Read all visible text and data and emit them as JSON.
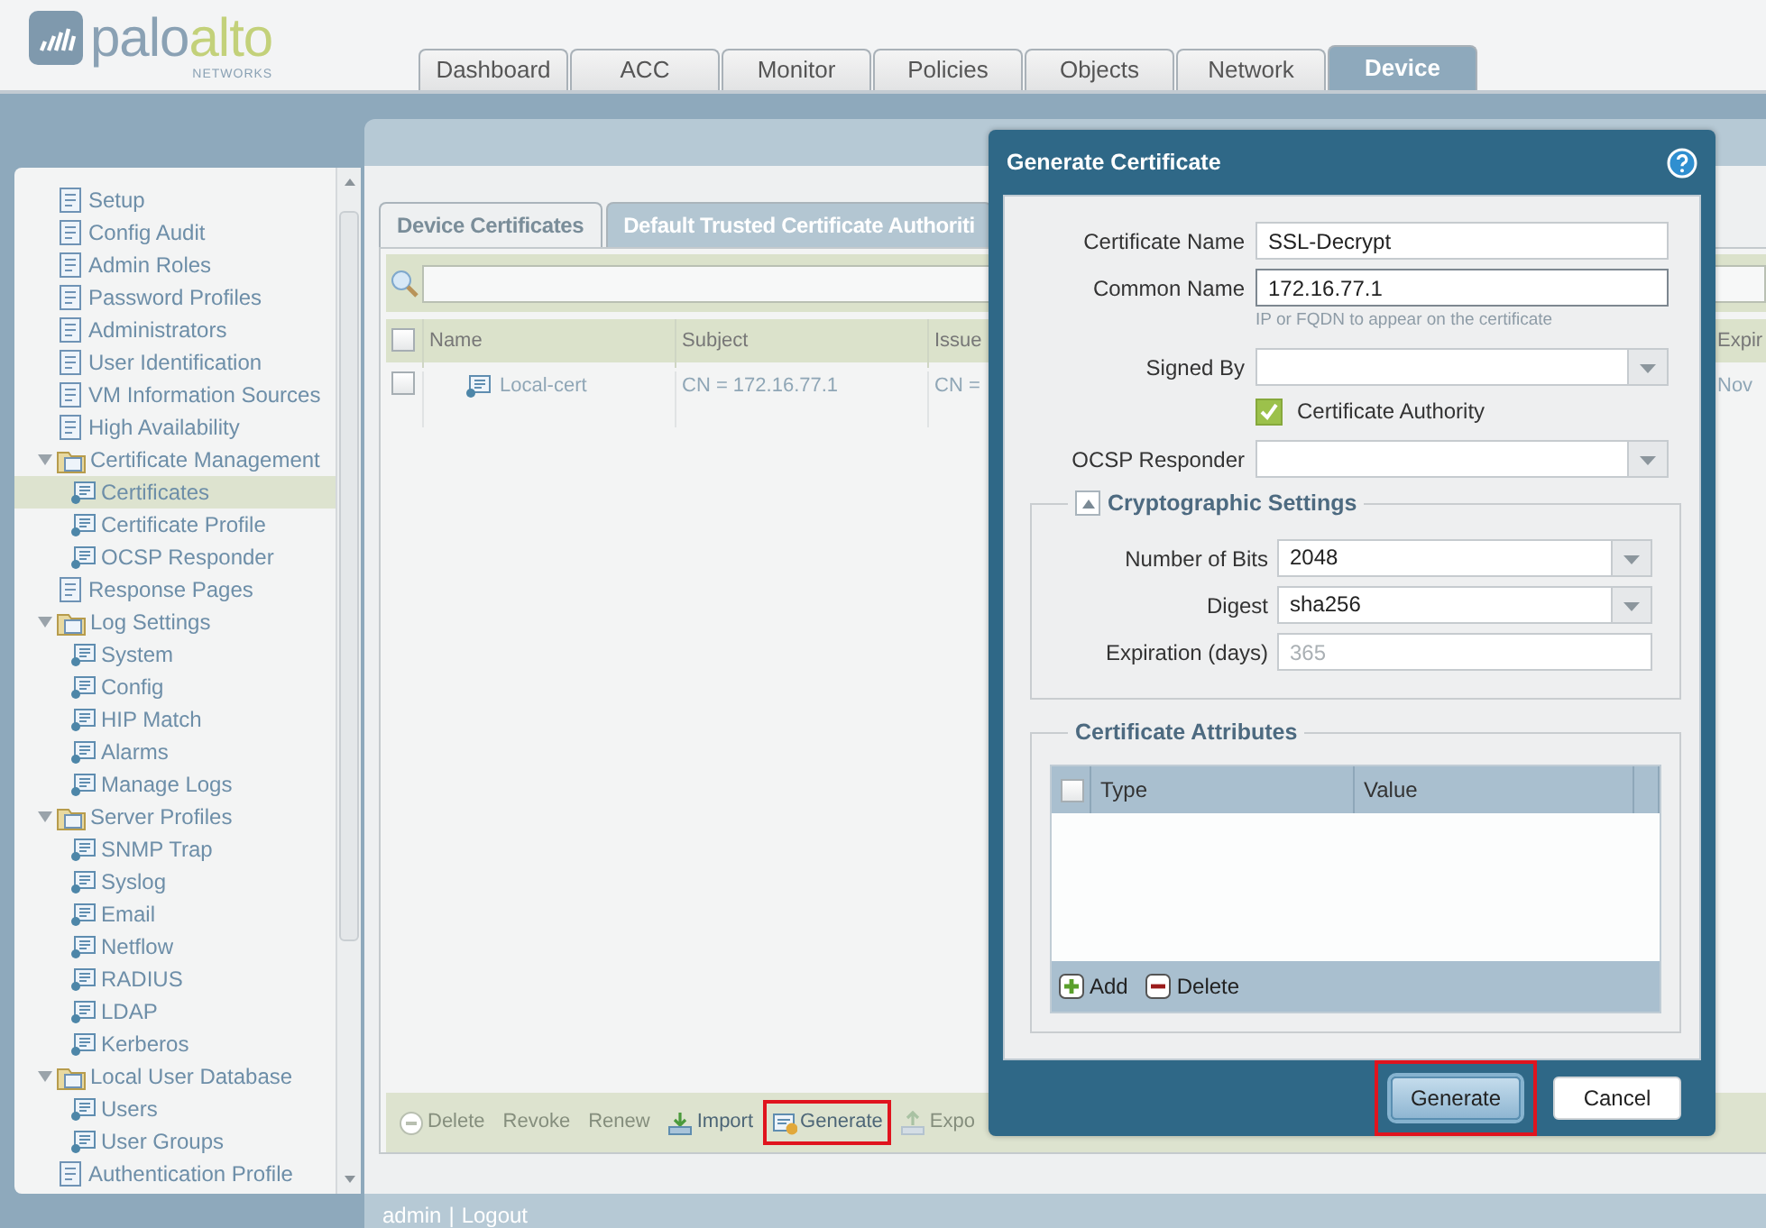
{
  "logo": {
    "brand_first": "palo",
    "brand_second": "alto",
    "tagline": "NETWORKS"
  },
  "top_tabs": [
    {
      "label": "Dashboard",
      "selected": false
    },
    {
      "label": "ACC",
      "selected": false
    },
    {
      "label": "Monitor",
      "selected": false
    },
    {
      "label": "Policies",
      "selected": false
    },
    {
      "label": "Objects",
      "selected": false
    },
    {
      "label": "Network",
      "selected": false
    },
    {
      "label": "Device",
      "selected": true
    }
  ],
  "sidebar": {
    "items": [
      {
        "label": "Setup",
        "selected": false
      },
      {
        "label": "Config Audit",
        "selected": false
      },
      {
        "label": "Admin Roles",
        "selected": false
      },
      {
        "label": "Password Profiles",
        "selected": false
      },
      {
        "label": "Administrators",
        "selected": false
      },
      {
        "label": "User Identification",
        "selected": false
      },
      {
        "label": "VM Information Sources",
        "selected": false
      },
      {
        "label": "High Availability",
        "selected": false
      },
      {
        "label": "Certificate Management",
        "selected": false,
        "expanded": true,
        "children": [
          {
            "label": "Certificates",
            "selected": true
          },
          {
            "label": "Certificate Profile",
            "selected": false
          },
          {
            "label": "OCSP Responder",
            "selected": false
          }
        ]
      },
      {
        "label": "Response Pages",
        "selected": false
      },
      {
        "label": "Log Settings",
        "selected": false,
        "expanded": true,
        "children": [
          {
            "label": "System",
            "selected": false
          },
          {
            "label": "Config",
            "selected": false
          },
          {
            "label": "HIP Match",
            "selected": false
          },
          {
            "label": "Alarms",
            "selected": false
          },
          {
            "label": "Manage Logs",
            "selected": false
          }
        ]
      },
      {
        "label": "Server Profiles",
        "selected": false,
        "expanded": true,
        "children": [
          {
            "label": "SNMP Trap",
            "selected": false
          },
          {
            "label": "Syslog",
            "selected": false
          },
          {
            "label": "Email",
            "selected": false
          },
          {
            "label": "Netflow",
            "selected": false
          },
          {
            "label": "RADIUS",
            "selected": false
          },
          {
            "label": "LDAP",
            "selected": false
          },
          {
            "label": "Kerberos",
            "selected": false
          }
        ]
      },
      {
        "label": "Local User Database",
        "selected": false,
        "expanded": true,
        "children": [
          {
            "label": "Users",
            "selected": false
          },
          {
            "label": "User Groups",
            "selected": false
          }
        ]
      },
      {
        "label": "Authentication Profile",
        "selected": false
      }
    ]
  },
  "content_tabs": [
    {
      "label": "Device Certificates",
      "selected": true
    },
    {
      "label": "Default Trusted Certificate Authoriti",
      "selected": false
    }
  ],
  "table": {
    "all_checked": false,
    "columns": [
      "Name",
      "Subject",
      "Issue",
      "Expir"
    ],
    "rows": [
      {
        "checked": false,
        "cells": [
          "Local-cert",
          "CN = 172.16.77.1",
          "CN =",
          "Nov"
        ]
      }
    ]
  },
  "toolbar": [
    {
      "label": "Delete",
      "kind": "remove",
      "disabled": true,
      "highlighted": false
    },
    {
      "label": "Revoke",
      "kind": "plain",
      "disabled": true,
      "highlighted": false
    },
    {
      "label": "Renew",
      "kind": "plain",
      "disabled": true,
      "highlighted": false
    },
    {
      "label": "Import",
      "kind": "import",
      "disabled": false,
      "highlighted": false
    },
    {
      "label": "Generate",
      "kind": "generate",
      "disabled": false,
      "highlighted": true
    },
    {
      "label": "Expo",
      "kind": "export",
      "disabled": true,
      "highlighted": false
    }
  ],
  "footer": {
    "user": "admin",
    "separator": "|",
    "logout": "Logout"
  },
  "dialog": {
    "title": "Generate Certificate",
    "fields": [
      {
        "label": "Certificate Name",
        "kind": "text",
        "value": "SSL-Decrypt",
        "focused": false
      },
      {
        "label": "Common Name",
        "kind": "text",
        "value": "172.16.77.1",
        "focused": true,
        "hint": "IP or FQDN to appear on the certificate"
      },
      {
        "label": "Signed By",
        "kind": "select"
      },
      {
        "label": "Certificate Authority",
        "kind": "checkbox",
        "checked": true
      },
      {
        "label": "OCSP Responder",
        "kind": "select"
      }
    ],
    "crypto": {
      "title": "Cryptographic Settings",
      "expanded": true,
      "fields": [
        {
          "label": "Number of Bits",
          "kind": "select",
          "value": "2048"
        },
        {
          "label": "Digest",
          "kind": "select",
          "value": "sha256"
        },
        {
          "label": "Expiration (days)",
          "kind": "text",
          "placeholder": "365",
          "focused": false
        }
      ]
    },
    "attributes": {
      "title": "Certificate Attributes",
      "all_checked": false,
      "columns": [
        "Type",
        "Value"
      ],
      "actions": [
        {
          "label": "Add",
          "kind": "add"
        },
        {
          "label": "Delete",
          "kind": "remove"
        }
      ]
    },
    "buttons": [
      {
        "label": "Generate",
        "kind": "primary",
        "highlighted": true
      },
      {
        "label": "Cancel",
        "kind": "secondary",
        "highlighted": false
      }
    ]
  }
}
